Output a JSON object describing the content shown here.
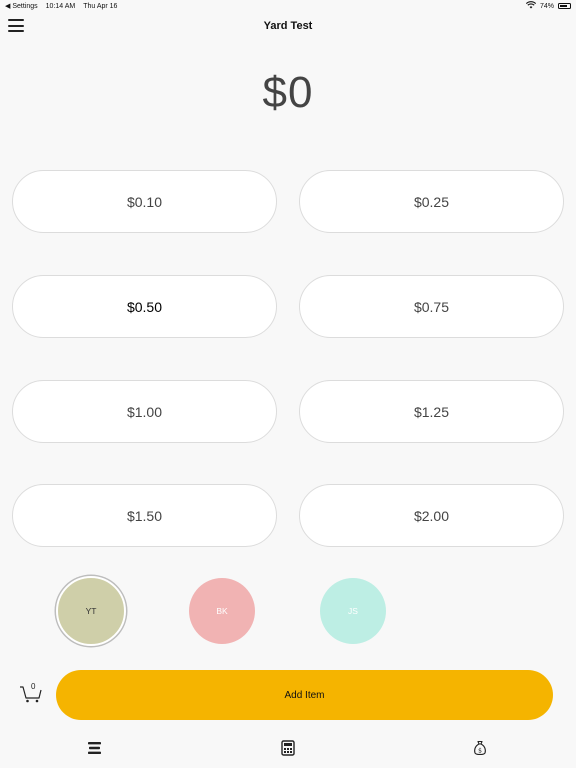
{
  "status_bar": {
    "back_app": "◀ Settings",
    "time": "10:14 AM",
    "date": "Thu Apr 16",
    "battery": "74%",
    "battery_level": 0.74
  },
  "header": {
    "title": "Yard Test"
  },
  "amount": "$0",
  "prices": [
    "$0.10",
    "$0.25",
    "$0.50",
    "$0.75",
    "$1.00",
    "$1.25",
    "$1.50",
    "$2.00"
  ],
  "selected_price_index": 2,
  "sellers": [
    {
      "initials": "YT",
      "color": "#cfcfa9",
      "text_color": "#333333",
      "selected": true
    },
    {
      "initials": "BK",
      "color": "#f1b3b3",
      "text_color": "#ffffff",
      "selected": false
    },
    {
      "initials": "JS",
      "color": "#bdeee4",
      "text_color": "#ffffff",
      "selected": false
    }
  ],
  "cart": {
    "count": "0"
  },
  "add_item": {
    "label": "Add Item",
    "color": "#f5b400"
  },
  "tabs": [
    {
      "icon": "list-icon"
    },
    {
      "icon": "calculator-icon"
    },
    {
      "icon": "money-bag-icon"
    }
  ]
}
